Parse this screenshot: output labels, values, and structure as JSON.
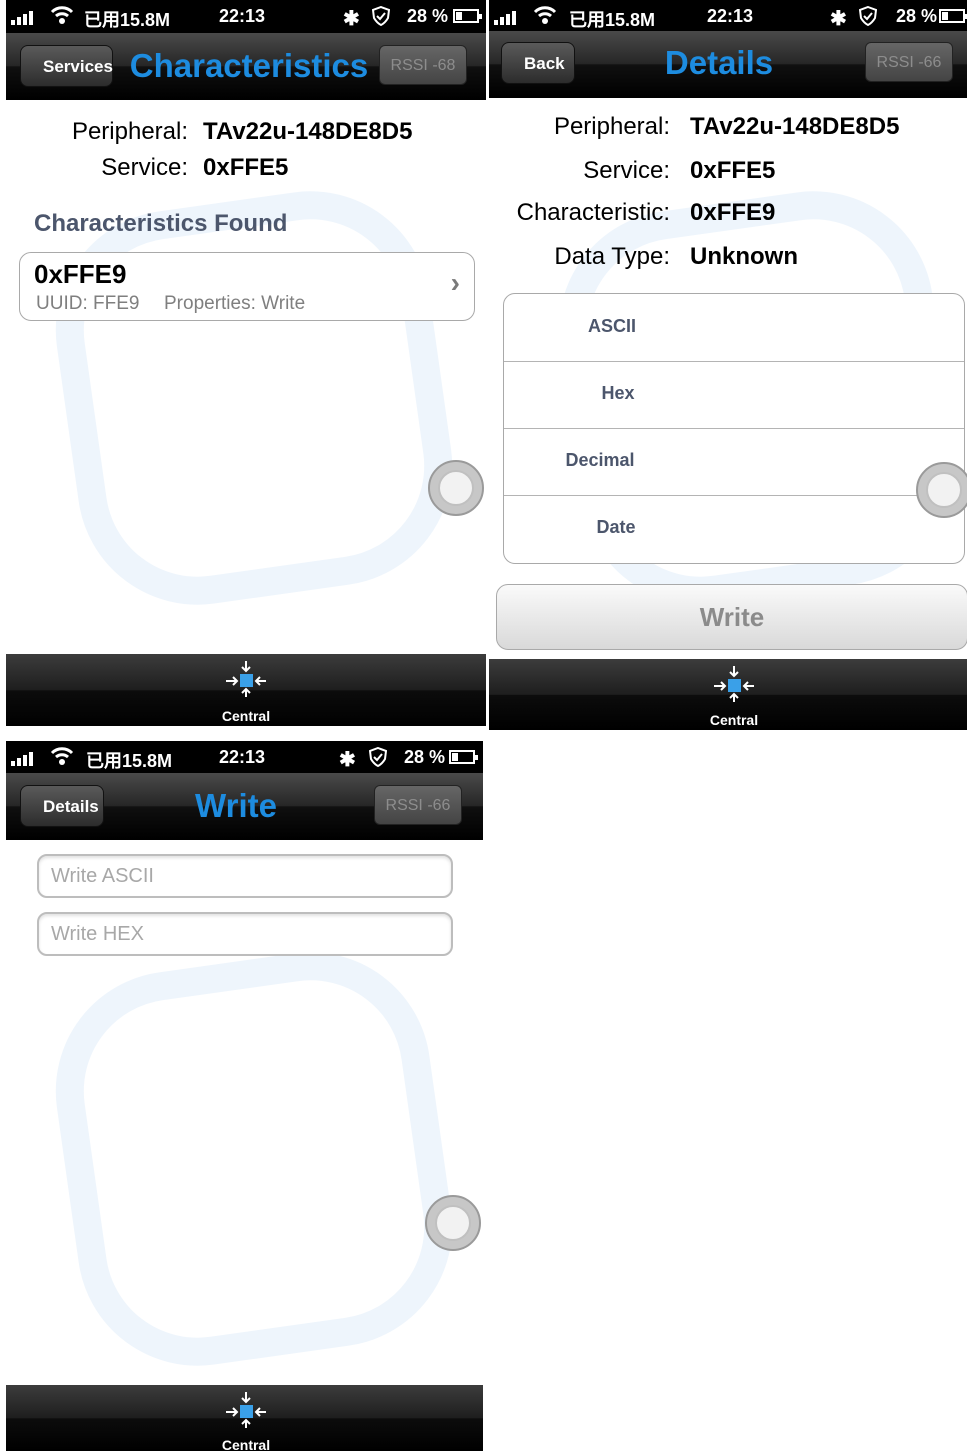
{
  "status_bar": {
    "data_used": "已用15.8M",
    "time": "22:13",
    "battery": "28 %"
  },
  "screens": [
    {
      "back_label": "Services",
      "title": "Characteristics",
      "rssi": "RSSI -68",
      "peripheral_label": "Peripheral:",
      "peripheral_value": "TAv22u-148DE8D5",
      "service_label": "Service:",
      "service_value": "0xFFE5",
      "section_title": "Characteristics Found",
      "items": [
        {
          "title": "0xFFE9",
          "uuid": "UUID: FFE9",
          "properties": "Properties: Write"
        }
      ],
      "tab_label": "Central"
    },
    {
      "back_label": "Back",
      "title": "Details",
      "rssi": "RSSI -66",
      "peripheral_label": "Peripheral:",
      "peripheral_value": "TAv22u-148DE8D5",
      "service_label": "Service:",
      "service_value": "0xFFE5",
      "characteristic_label": "Characteristic:",
      "characteristic_value": "0xFFE9",
      "data_type_label": "Data Type:",
      "data_type_value": "Unknown",
      "formats": [
        "ASCII",
        "Hex",
        "Decimal",
        "Date"
      ],
      "write_button": "Write",
      "tab_label": "Central"
    },
    {
      "back_label": "Details",
      "title": "Write",
      "rssi": "RSSI -66",
      "ascii_placeholder": "Write ASCII",
      "hex_placeholder": "Write HEX",
      "tab_label": "Central"
    }
  ],
  "colors": {
    "title_blue": "#1d8ce0",
    "section_gray_blue": "#4c566c",
    "tab_icon_blue": "#3aa0e8"
  },
  "icons": [
    "signal-bars-icon",
    "wifi-icon",
    "bluetooth-icon",
    "shield-icon",
    "battery-icon",
    "central-tab-icon",
    "assistive-touch-icon"
  ]
}
